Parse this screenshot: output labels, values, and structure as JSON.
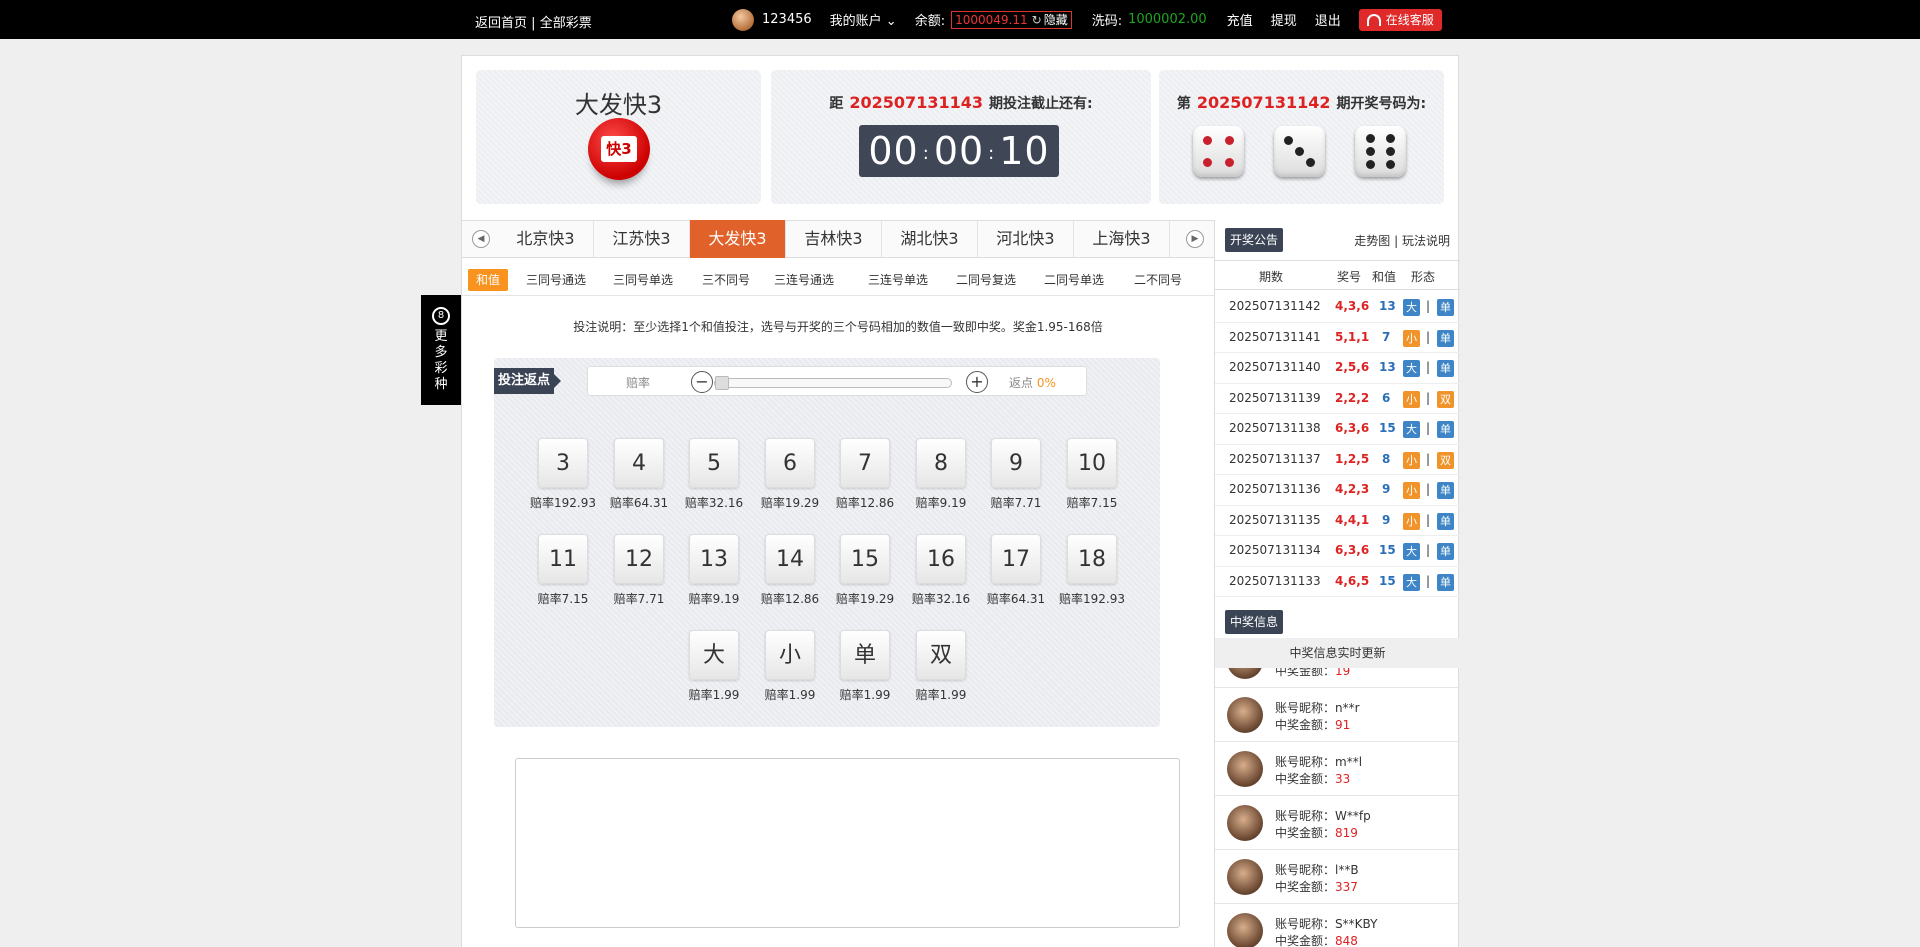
{
  "topbar": {
    "home_link": "返回首页",
    "all_lottery_link": "全部彩票",
    "divider": "|",
    "username": "123456",
    "account_menu": "我的账户",
    "balance_label": "余额:",
    "balance_value": "1000049.11",
    "hide_label": "隐藏",
    "wash_label": "洗码:",
    "wash_value": "1000002.00",
    "recharge": "充值",
    "withdraw": "提现",
    "logout": "退出",
    "service": "在线客服"
  },
  "header": {
    "lottery_name": "大发快3",
    "logo_text": "快3",
    "countdown_prefix": "距",
    "countdown_issue": "202507131143",
    "countdown_suffix": "期投注截止还有:",
    "timer_h": "00",
    "timer_m": "00",
    "timer_s": "10",
    "colon": ":",
    "result_prefix": "第",
    "result_issue": "202507131142",
    "result_suffix": "期开奖号码为:",
    "dice": [
      4,
      3,
      6
    ]
  },
  "tabs": [
    "北京快3",
    "江苏快3",
    "大发快3",
    "吉林快3",
    "湖北快3",
    "河北快3",
    "上海快3"
  ],
  "active_tab": 2,
  "subtabs": [
    "和值",
    "三同号通选",
    "三同号单选",
    "三不同号",
    "三连号通选",
    "三连号单选",
    "二同号复选",
    "二同号单选",
    "二不同号"
  ],
  "side_float": {
    "icon": "8",
    "text": [
      "更",
      "多",
      "彩",
      "种"
    ]
  },
  "tip": "投注说明：至少选择1个和值投注，选号与开奖的三个号码相加的数值一致即中奖。奖金1.95-168倍",
  "rebate": {
    "tag": "投注返点",
    "odds_label": "赔率",
    "minus": "−",
    "plus": "+",
    "rebate_label": "返点",
    "rebate_value": "0%",
    "level": 0
  },
  "bets": [
    {
      "n": "3",
      "odds": "赔率192.93"
    },
    {
      "n": "4",
      "odds": "赔率64.31"
    },
    {
      "n": "5",
      "odds": "赔率32.16"
    },
    {
      "n": "6",
      "odds": "赔率19.29"
    },
    {
      "n": "7",
      "odds": "赔率12.86"
    },
    {
      "n": "8",
      "odds": "赔率9.19"
    },
    {
      "n": "9",
      "odds": "赔率7.71"
    },
    {
      "n": "10",
      "odds": "赔率7.15"
    },
    {
      "n": "11",
      "odds": "赔率7.15"
    },
    {
      "n": "12",
      "odds": "赔率7.71"
    },
    {
      "n": "13",
      "odds": "赔率9.19"
    },
    {
      "n": "14",
      "odds": "赔率12.86"
    },
    {
      "n": "15",
      "odds": "赔率19.29"
    },
    {
      "n": "16",
      "odds": "赔率32.16"
    },
    {
      "n": "17",
      "odds": "赔率64.31"
    },
    {
      "n": "18",
      "odds": "赔率192.93"
    },
    {
      "n": "大",
      "odds": "赔率1.99"
    },
    {
      "n": "小",
      "odds": "赔率1.99"
    },
    {
      "n": "单",
      "odds": "赔率1.99"
    },
    {
      "n": "双",
      "odds": "赔率1.99"
    }
  ],
  "right": {
    "notice_tag": "开奖公告",
    "trend_link": "走势图",
    "rules_link": "玩法说明",
    "link_divider": "|",
    "cols": [
      "期数",
      "奖号",
      "和值",
      "形态"
    ],
    "draws": [
      {
        "issue": "202507131142",
        "nums": "4,3,6",
        "sum": "13",
        "size": "大",
        "parity": "单"
      },
      {
        "issue": "202507131141",
        "nums": "5,1,1",
        "sum": "7",
        "size": "小",
        "parity": "单"
      },
      {
        "issue": "202507131140",
        "nums": "2,5,6",
        "sum": "13",
        "size": "大",
        "parity": "单"
      },
      {
        "issue": "202507131139",
        "nums": "2,2,2",
        "sum": "6",
        "size": "小",
        "parity": "双"
      },
      {
        "issue": "202507131138",
        "nums": "6,3,6",
        "sum": "15",
        "size": "大",
        "parity": "单"
      },
      {
        "issue": "202507131137",
        "nums": "1,2,5",
        "sum": "8",
        "size": "小",
        "parity": "双"
      },
      {
        "issue": "202507131136",
        "nums": "4,2,3",
        "sum": "9",
        "size": "小",
        "parity": "单"
      },
      {
        "issue": "202507131135",
        "nums": "4,4,1",
        "sum": "9",
        "size": "小",
        "parity": "单"
      },
      {
        "issue": "202507131134",
        "nums": "6,3,6",
        "sum": "15",
        "size": "大",
        "parity": "单"
      },
      {
        "issue": "202507131133",
        "nums": "4,6,5",
        "sum": "15",
        "size": "大",
        "parity": "单"
      }
    ],
    "win_tag": "中奖信息",
    "win_bar": "中奖信息实时更新",
    "nick_label": "账号昵称：",
    "amount_label": "中奖金额：",
    "winners": [
      {
        "nick": "",
        "amount": "19"
      },
      {
        "nick": "n**r",
        "amount": "91"
      },
      {
        "nick": "m**l",
        "amount": "33"
      },
      {
        "nick": "W**fp",
        "amount": "819"
      },
      {
        "nick": "l**B",
        "amount": "337"
      },
      {
        "nick": "S**KBY",
        "amount": "848"
      }
    ]
  },
  "colors": {
    "accent": "#e0622a",
    "orange": "#f7931e",
    "red": "#d22222",
    "blue": "#3d85c6",
    "dark": "#3a4455"
  }
}
